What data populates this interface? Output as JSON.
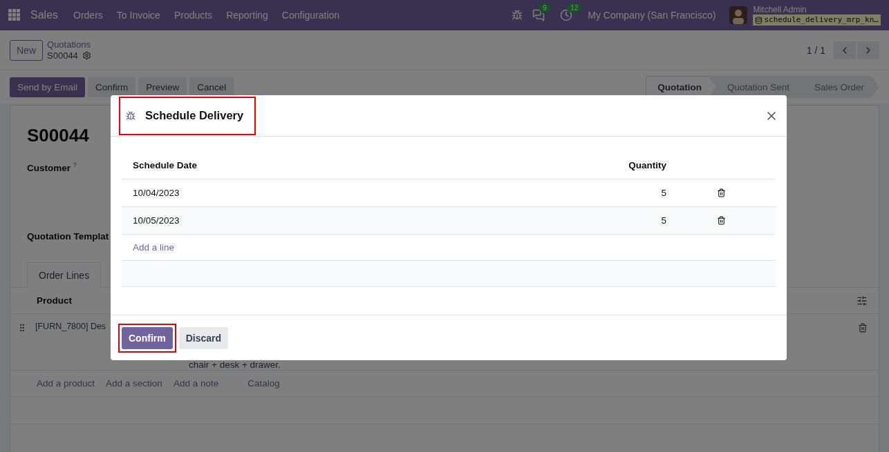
{
  "navbar": {
    "app": "Sales",
    "menu": [
      "Orders",
      "To Invoice",
      "Products",
      "Reporting",
      "Configuration"
    ],
    "chat_count": "9",
    "activity_count": "12",
    "company": "My Company (San Francisco)",
    "user": "Mitchell Admin",
    "database": "schedule_delivery_mrp_kn…"
  },
  "control_panel": {
    "new_button": "New",
    "breadcrumb": "Quotations",
    "record": "S00044",
    "pager": "1 / 1"
  },
  "actions": [
    {
      "label": "Send by Email",
      "primary": true
    },
    {
      "label": "Confirm",
      "primary": false
    },
    {
      "label": "Preview",
      "primary": false
    },
    {
      "label": "Cancel",
      "primary": false
    }
  ],
  "stages": [
    {
      "label": "Quotation",
      "selected": true
    },
    {
      "label": "Quotation Sent",
      "selected": false
    },
    {
      "label": "Sales Order",
      "selected": false
    }
  ],
  "form": {
    "title": "S00044",
    "customer_label": "Customer",
    "help_mark": "?",
    "template_label": "Quotation Templat",
    "tabs": [
      {
        "label": "Order Lines",
        "selected": true
      }
    ],
    "columns": [
      "Product"
    ],
    "lines": [
      {
        "product": "[FURN_7800] Des",
        "description": "chair + desk + drawer."
      }
    ],
    "add_links": [
      "Add a product",
      "Add a section",
      "Add a note",
      "Catalog"
    ]
  },
  "dialog": {
    "title": "Schedule Delivery",
    "columns": [
      "Schedule Date",
      "Quantity"
    ],
    "rows": [
      {
        "date": "10/04/2023",
        "quantity": "5"
      },
      {
        "date": "10/05/2023",
        "quantity": "5"
      }
    ],
    "add_line": "Add a line",
    "buttons": [
      {
        "label": "Confirm",
        "primary": true
      },
      {
        "label": "Discard",
        "primary": false
      }
    ]
  }
}
